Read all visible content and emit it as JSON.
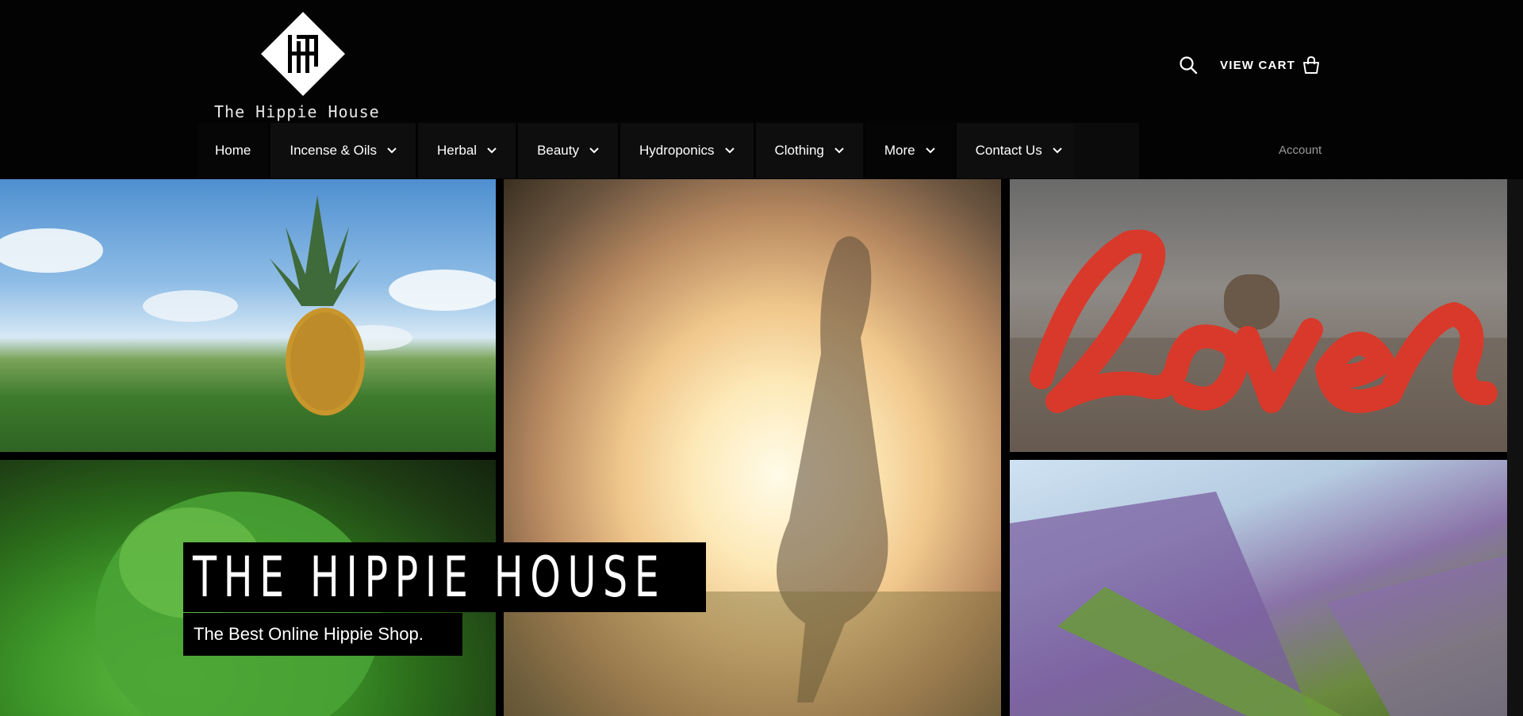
{
  "brand": {
    "logo_monogram": "HH",
    "name": "The Hippie House"
  },
  "header": {
    "search_icon": "search-icon",
    "cart_label": "VIEW CART",
    "cart_icon": "shopping-bag-icon",
    "account_label": "Account"
  },
  "nav": {
    "items": [
      {
        "label": "Home",
        "has_dropdown": false
      },
      {
        "label": "Incense & Oils",
        "has_dropdown": true
      },
      {
        "label": "Herbal",
        "has_dropdown": true
      },
      {
        "label": "Beauty",
        "has_dropdown": true
      },
      {
        "label": "Hydroponics",
        "has_dropdown": true
      },
      {
        "label": "Clothing",
        "has_dropdown": true
      },
      {
        "label": "More",
        "has_dropdown": true
      },
      {
        "label": "Contact Us",
        "has_dropdown": true
      }
    ]
  },
  "hero": {
    "title": "THE HIPPIE HOUSE",
    "subtitle": "The Best Online Hippie Shop.",
    "tiles": [
      {
        "subject": "pineapple in grass field"
      },
      {
        "subject": "girl dancing in sunlit meadow"
      },
      {
        "subject": "red wooden love sign"
      },
      {
        "subject": "green tree"
      },
      {
        "subject": "lavender bundle"
      }
    ]
  },
  "colors": {
    "header_bg": "#030303",
    "nav_item_bg": "#0e0e0e",
    "text": "#ffffff",
    "account_text": "#9a9a9a"
  }
}
